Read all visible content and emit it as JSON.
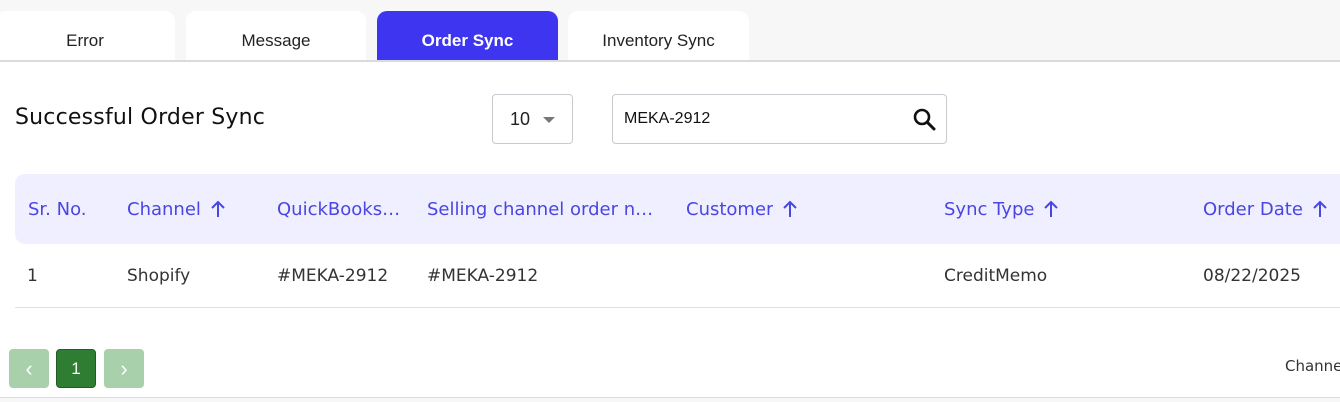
{
  "tabs": [
    {
      "label": "Error",
      "active": false
    },
    {
      "label": "Message",
      "active": false
    },
    {
      "label": "Order Sync",
      "active": true
    },
    {
      "label": "Inventory Sync",
      "active": false
    }
  ],
  "panel": {
    "title": "Successful Order Sync",
    "page_size": "10",
    "search": {
      "value": "MEKA-2912",
      "icon": "search-icon"
    }
  },
  "table": {
    "headers": [
      "Sr. No.",
      "Channel",
      "QuickBooks ...",
      "Selling channel order nu...",
      "Customer",
      "Sync Type",
      "Order Date"
    ],
    "rows": [
      {
        "sr": "1",
        "channel": "Shopify",
        "quickbooks": "#MEKA-2912",
        "selling_order": "#MEKA-2912",
        "customer": "",
        "sync_type": "CreditMemo",
        "order_date": "08/22/2025"
      }
    ]
  },
  "pagination": {
    "prev": "‹",
    "current": "1",
    "next": "›"
  },
  "footer": {
    "text": "Channe"
  },
  "colors": {
    "accent": "#3d35ef",
    "header_text": "#4a45e3",
    "pager_active": "#2e7d32",
    "pager_disabled": "#a8d0aa"
  }
}
